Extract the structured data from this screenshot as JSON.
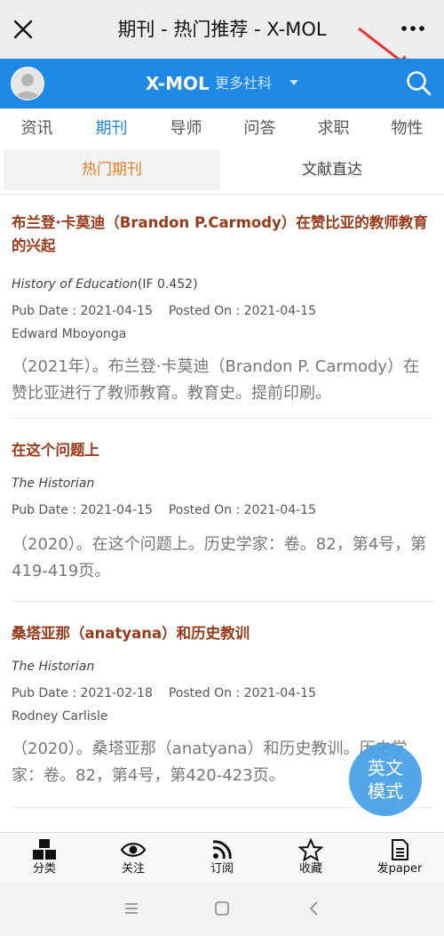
{
  "window": {
    "title": "期刊 - 热门推荐 - X-MOL"
  },
  "header": {
    "brand": "X-MOL",
    "site_selector": "更多社科"
  },
  "nav": {
    "tabs": [
      "资讯",
      "期刊",
      "导师",
      "问答",
      "求职",
      "物性"
    ],
    "active": 1
  },
  "subtabs": {
    "left": "热门期刊",
    "right": "文献直达"
  },
  "articles": [
    {
      "title": "布兰登·卡莫迪（Brandon P.Carmody）在赞比亚的教师教育的兴起",
      "journal": "History of Education",
      "impact": "(IF 0.452)",
      "pub_date": "Pub Date : 2021-04-15",
      "posted_on": "Posted On : 2021-04-15",
      "author": "Edward Mboyonga",
      "abstract": "（2021年）。布兰登·卡莫迪（Brandon P. Carmody）在赞比亚进行了教师教育。教育史。提前印刷。"
    },
    {
      "title": "在这个问题上",
      "journal": "The Historian",
      "impact": "",
      "pub_date": "Pub Date : 2021-04-15",
      "posted_on": "Posted On : 2021-04-15",
      "author": "",
      "abstract": "（2020）。在这个问题上。历史学家：卷。82，第4号，第419-419页。"
    },
    {
      "title": "桑塔亚那（anatyana）和历史教训",
      "journal": "The Historian",
      "impact": "",
      "pub_date": "Pub Date : 2021-02-18",
      "posted_on": "Posted On : 2021-04-15",
      "author": "Rodney Carlisle",
      "abstract": "（2020）。桑塔亚那（anatyana）和历史教训。历史学家：卷。82，第4号，第420-423页。"
    }
  ],
  "fab": {
    "line1": "英文",
    "line2": "模式"
  },
  "bottom_nav": [
    "分类",
    "关注",
    "订阅",
    "收藏",
    "发paper"
  ],
  "colors": {
    "brand_blue": "#1e88e5",
    "title_red": "#9b3a1b",
    "tab_orange": "#e67e22"
  }
}
